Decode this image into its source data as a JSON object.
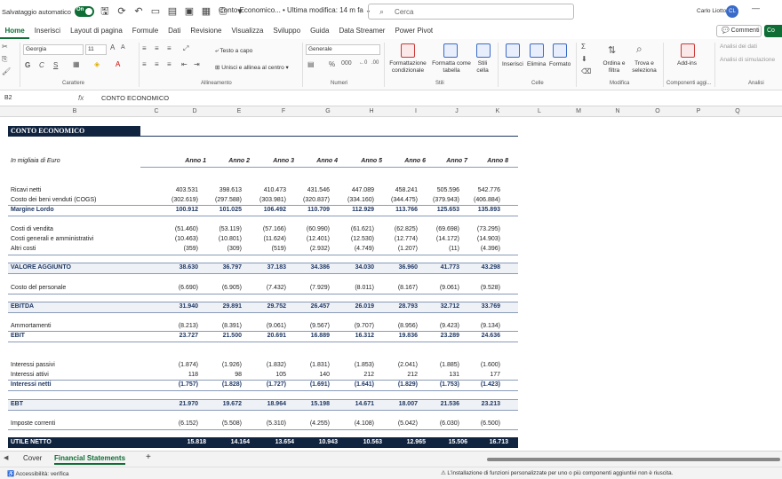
{
  "titlebar": {
    "autosave_label": "Salvataggio automatico",
    "toggle_state": "On",
    "doc_title": "Conto Economico... • Ultima modifica: 14 m fa ⌄",
    "search_placeholder": "Cerca",
    "user_name": "Carlo Liotto",
    "user_initials": "CL",
    "minimize": "—"
  },
  "menubar": {
    "tabs": [
      "Home",
      "Inserisci",
      "Layout di pagina",
      "Formule",
      "Dati",
      "Revisione",
      "Visualizza",
      "Sviluppo",
      "Guida",
      "Data Streamer",
      "Power Pivot"
    ],
    "active": "Home",
    "comments": "Commenti",
    "share": "Co"
  },
  "ribbon": {
    "font_name": "Georgia",
    "font_size": "11",
    "wrap_text": "Testo a capo",
    "merge_center": "Unisci e allinea al centro",
    "number_format": "Generale",
    "cond_format": "Formattazione condizionale",
    "format_table": "Formatta come tabella",
    "cell_styles": "Stili cella",
    "insert": "Inserisci",
    "delete": "Elimina",
    "format": "Formato",
    "sort_filter": "Ordina e filtra",
    "find_select": "Trova e seleziona",
    "addins": "Add-ins",
    "analyze_data": "Analisi dei dati",
    "sim_analysis": "Analisi di simulazione",
    "groups": [
      "Carattere",
      "Allineamento",
      "Numeri",
      "Stili",
      "Celle",
      "Modifica",
      "Componenti aggi...",
      "Analisi"
    ]
  },
  "formulabar": {
    "namebox": "B2",
    "fx": "fx",
    "content": "CONTO ECONOMICO"
  },
  "columns": [
    "B",
    "C",
    "D",
    "E",
    "F",
    "G",
    "H",
    "I",
    "J",
    "K",
    "L",
    "M",
    "N",
    "O",
    "P",
    "Q"
  ],
  "sheet": {
    "title": "CONTO ECONOMICO",
    "unit_label": "In migliaia di Euro",
    "years": [
      "Anno 1",
      "Anno 2",
      "Anno 3",
      "Anno 4",
      "Anno 5",
      "Anno 6",
      "Anno 7",
      "Anno 8"
    ],
    "rows": [
      {
        "label": "Ricavi netti",
        "values": [
          "403.531",
          "398.613",
          "410.473",
          "431.546",
          "447.089",
          "458.241",
          "505.596",
          "542.776"
        ]
      },
      {
        "label": "Costo dei beni venduti (COGS)",
        "values": [
          "(302.619)",
          "(297.588)",
          "(303.981)",
          "(320.837)",
          "(334.160)",
          "(344.475)",
          "(379.943)",
          "(406.884)"
        ]
      },
      {
        "label": "Margine Lordo",
        "values": [
          "100.912",
          "101.025",
          "106.492",
          "110.709",
          "112.929",
          "113.766",
          "125.653",
          "135.893"
        ]
      },
      {
        "label": "Costi di vendita",
        "values": [
          "(51.460)",
          "(53.119)",
          "(57.166)",
          "(60.990)",
          "(61.621)",
          "(62.825)",
          "(69.698)",
          "(73.295)"
        ]
      },
      {
        "label": "Costi generali e amministrativi",
        "values": [
          "(10.463)",
          "(10.801)",
          "(11.624)",
          "(12.401)",
          "(12.530)",
          "(12.774)",
          "(14.172)",
          "(14.903)"
        ]
      },
      {
        "label": "Altri costi",
        "values": [
          "(359)",
          "(309)",
          "(519)",
          "(2.932)",
          "(4.749)",
          "(1.207)",
          "(11)",
          "(4.396)"
        ]
      },
      {
        "label": "VALORE AGGIUNTO",
        "values": [
          "38.630",
          "36.797",
          "37.183",
          "34.386",
          "34.030",
          "36.960",
          "41.773",
          "43.298"
        ]
      },
      {
        "label": "Costo del personale",
        "values": [
          "(6.690)",
          "(6.905)",
          "(7.432)",
          "(7.929)",
          "(8.011)",
          "(8.167)",
          "(9.061)",
          "(9.528)"
        ]
      },
      {
        "label": "EBITDA",
        "values": [
          "31.940",
          "29.891",
          "29.752",
          "26.457",
          "26.019",
          "28.793",
          "32.712",
          "33.769"
        ]
      },
      {
        "label": "Ammortamenti",
        "values": [
          "(8.213)",
          "(8.391)",
          "(9.061)",
          "(9.567)",
          "(9.707)",
          "(8.956)",
          "(9.423)",
          "(9.134)"
        ]
      },
      {
        "label": "EBIT",
        "values": [
          "23.727",
          "21.500",
          "20.691",
          "16.889",
          "16.312",
          "19.836",
          "23.289",
          "24.636"
        ]
      },
      {
        "label": "Interessi passivi",
        "values": [
          "(1.874)",
          "(1.926)",
          "(1.832)",
          "(1.831)",
          "(1.853)",
          "(2.041)",
          "(1.885)",
          "(1.600)"
        ]
      },
      {
        "label": "Interessi attivi",
        "values": [
          "118",
          "98",
          "105",
          "140",
          "212",
          "212",
          "131",
          "177"
        ]
      },
      {
        "label": "Interessi netti",
        "values": [
          "(1.757)",
          "(1.828)",
          "(1.727)",
          "(1.691)",
          "(1.641)",
          "(1.829)",
          "(1.753)",
          "(1.423)"
        ]
      },
      {
        "label": "EBT",
        "values": [
          "21.970",
          "19.672",
          "18.964",
          "15.198",
          "14.671",
          "18.007",
          "21.536",
          "23.213"
        ]
      },
      {
        "label": "Imposte correnti",
        "values": [
          "(6.152)",
          "(5.508)",
          "(5.310)",
          "(4.255)",
          "(4.108)",
          "(5.042)",
          "(6.030)",
          "(6.500)"
        ]
      },
      {
        "label": "UTILE NETTO",
        "values": [
          "15.818",
          "14.164",
          "13.654",
          "10.943",
          "10.563",
          "12.965",
          "15.506",
          "16.713"
        ]
      }
    ]
  },
  "sheettabs": {
    "tabs": [
      "Cover",
      "Financial Statements"
    ],
    "active": "Financial Statements",
    "add": "+"
  },
  "statusbar": {
    "accessibility": "Accessibilità: verifica",
    "message": "L'installazione di funzioni personalizzate per uno o più componenti aggiuntivi non è riuscita."
  }
}
